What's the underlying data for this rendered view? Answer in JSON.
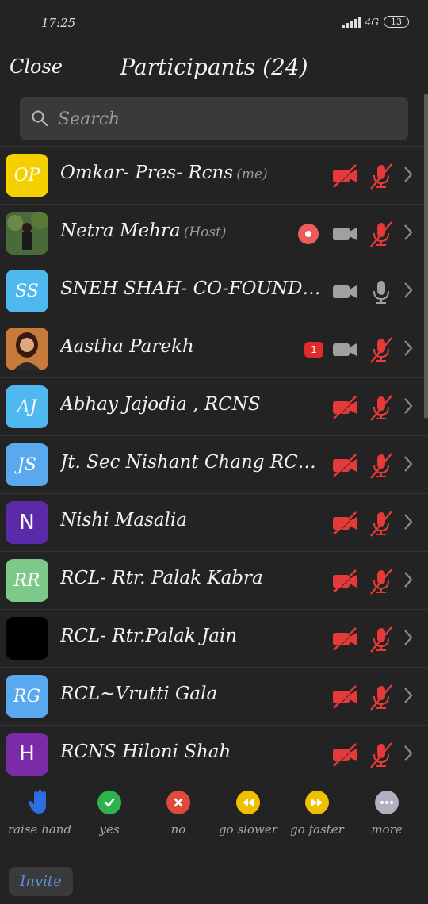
{
  "status": {
    "time": "17:25",
    "network": "4G",
    "battery": "13"
  },
  "header": {
    "close_label": "Close",
    "title": "Participants (24)"
  },
  "search": {
    "placeholder": "Search"
  },
  "participants": [
    {
      "initials": "OP",
      "name": "Omkar- Pres- Rcns",
      "tag": "(me)",
      "avatar_color": "#f5d000"
    },
    {
      "initials": "",
      "name": "Netra Mehra",
      "tag": "(Host)",
      "avatar_color": "#3a5a3a"
    },
    {
      "initials": "SS",
      "name": "SNEH SHAH- CO-FOUNDER...",
      "tag": "",
      "avatar_color": "#4fb8ef"
    },
    {
      "initials": "",
      "name": "Aastha Parekh",
      "tag": "",
      "avatar_color": "#8a4a2a",
      "badge": "1"
    },
    {
      "initials": "AJ",
      "name": "Abhay Jajodia , RCNS",
      "tag": "",
      "avatar_color": "#4fb8ef"
    },
    {
      "initials": "JS",
      "name": "Jt. Sec Nishant Chang RCVESC...",
      "tag": "",
      "avatar_color": "#5aa8ee"
    },
    {
      "initials": "N",
      "name": "Nishi Masalia",
      "tag": "",
      "avatar_color": "#5b2aa8"
    },
    {
      "initials": "RR",
      "name": "RCL- Rtr. Palak Kabra",
      "tag": "",
      "avatar_color": "#7cc98a"
    },
    {
      "initials": "",
      "name": "RCL- Rtr.Palak Jain",
      "tag": "",
      "avatar_color": "#000000"
    },
    {
      "initials": "RG",
      "name": "RCL~Vrutti Gala",
      "tag": "",
      "avatar_color": "#5aa8ee"
    },
    {
      "initials": "H",
      "name": "RCNS Hiloni Shah",
      "tag": "",
      "avatar_color": "#7b2aa8"
    }
  ],
  "reactions": [
    {
      "label": "raise hand",
      "color": "#2d6fe0",
      "icon": "hand-icon"
    },
    {
      "label": "yes",
      "color": "#2eb24c",
      "icon": "check-icon"
    },
    {
      "label": "no",
      "color": "#e04a3a",
      "icon": "x-icon"
    },
    {
      "label": "go slower",
      "color": "#f0c000",
      "icon": "rewind-icon"
    },
    {
      "label": "go faster",
      "color": "#f0c000",
      "icon": "fast-forward-icon"
    },
    {
      "label": "more",
      "color": "#b0b0c0",
      "icon": "more-icon"
    }
  ],
  "invite_label": "Invite",
  "colors": {
    "muted_red": "#e63a3a",
    "icon_gray": "#a0a0a0",
    "invite_blue": "#5b8fd8"
  }
}
